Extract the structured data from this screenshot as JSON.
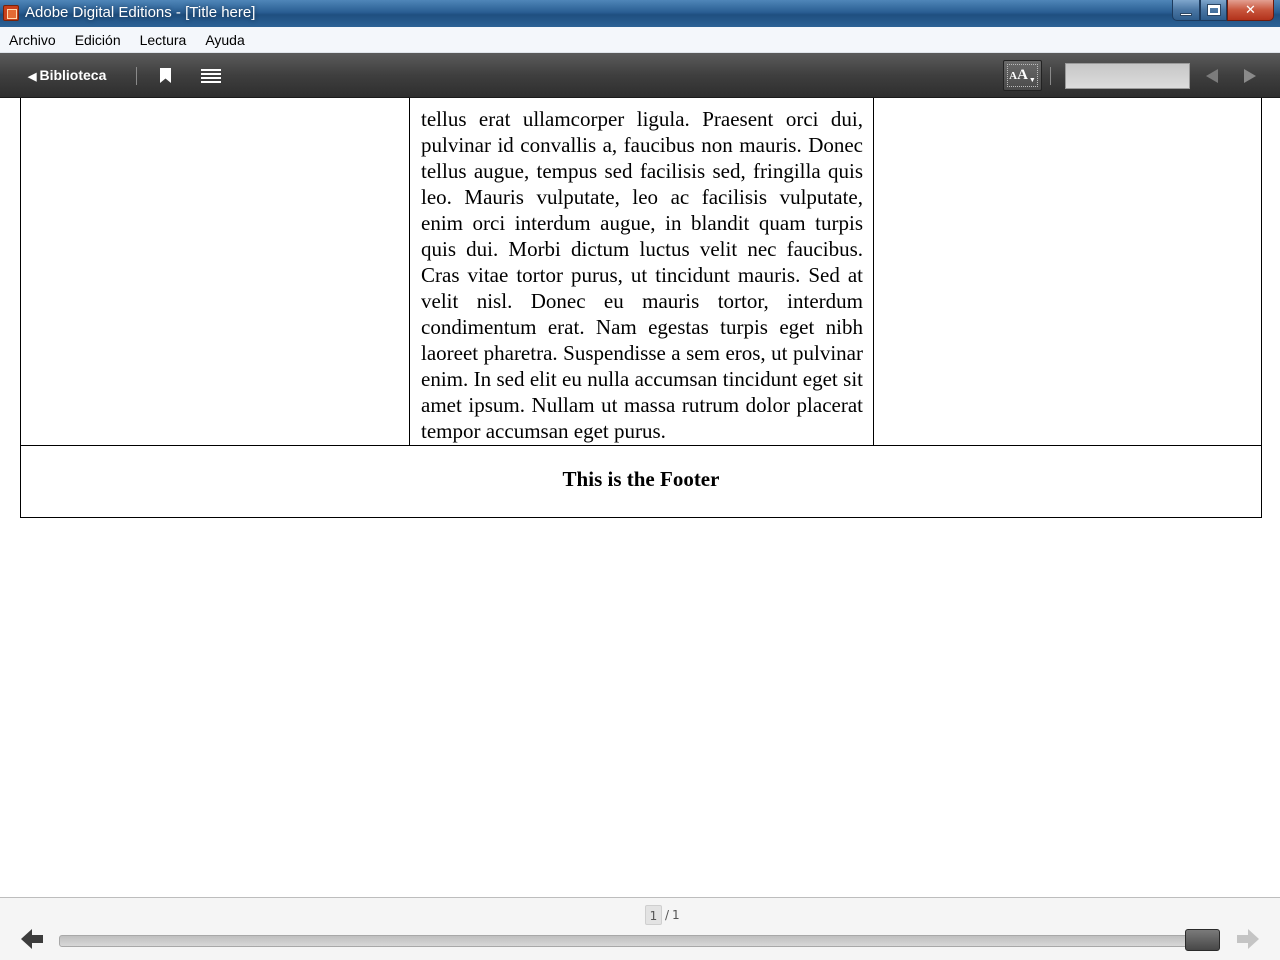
{
  "window": {
    "title": "Adobe Digital Editions - [Title here]",
    "icon": "adobe-digital-editions-icon",
    "controls": {
      "minimize_icon": "minimize-icon",
      "maximize_icon": "restore-icon",
      "close_glyph": "✕"
    }
  },
  "menubar": {
    "items": [
      {
        "label": "Archivo"
      },
      {
        "label": "Edición"
      },
      {
        "label": "Lectura"
      },
      {
        "label": "Ayuda"
      }
    ]
  },
  "toolbar": {
    "back_arrow": "◀",
    "back_label": "Biblioteca",
    "bookmark_icon": "bookmark-icon",
    "toc_icon": "list-icon",
    "font_size": {
      "small": "A",
      "large": "A",
      "caret": "▼"
    },
    "search": {
      "value": "",
      "placeholder": ""
    },
    "search_prev_icon": "triangle-left-icon",
    "search_next_icon": "triangle-right-icon"
  },
  "document": {
    "body_text": "tellus erat ullamcorper ligula. Praesent orci dui, pulvinar id convallis a, faucibus non mauris. Donec tellus augue, tempus sed facilisis sed, fringilla quis leo. Mauris vulputate, leo ac facilisis vulputate, enim orci interdum augue, in blandit quam turpis quis dui. Morbi dictum luctus velit nec faucibus. Cras vitae tortor purus, ut tincidunt mauris. Sed at velit nisl. Donec eu mauris tortor, interdum condimentum erat. Nam egestas turpis eget nibh laoreet pharetra. Suspendisse a sem eros, ut pulvinar enim. In sed elit eu nulla accumsan tincidunt eget sit amet ipsum. Nullam ut massa rutrum dolor placerat tempor accumsan eget purus.",
    "footer": "This is the Footer"
  },
  "navigation": {
    "current_page": "1",
    "separator": "/",
    "total_pages": "1",
    "progress": 1.0,
    "prev_icon": "arrow-left-icon",
    "next_icon": "arrow-right-icon"
  }
}
